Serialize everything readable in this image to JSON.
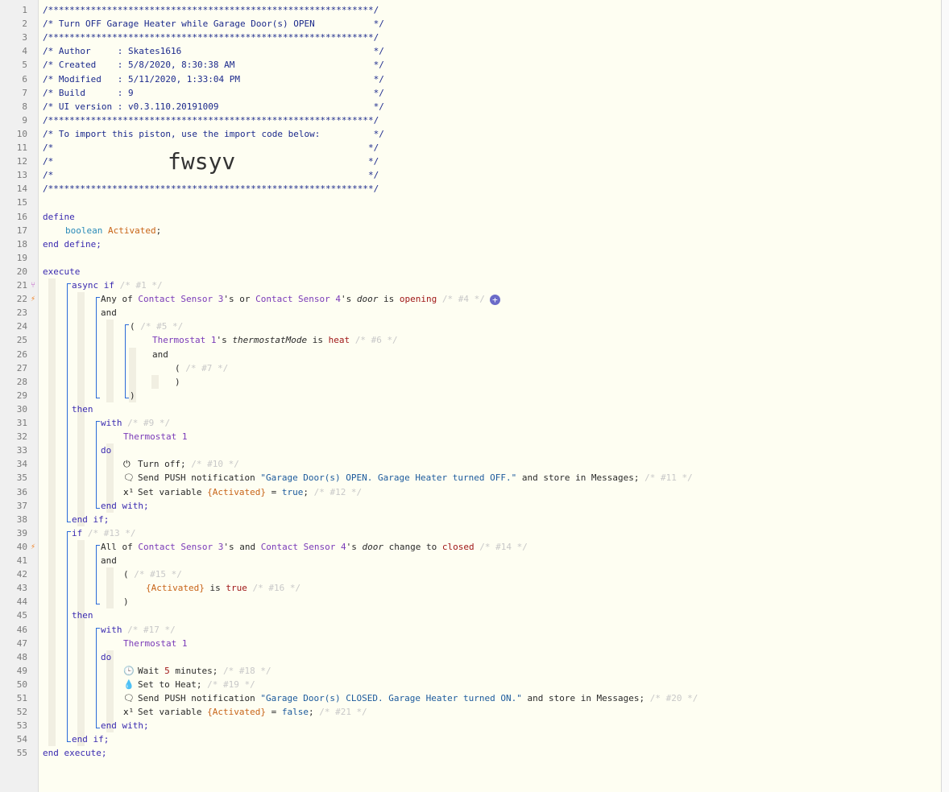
{
  "markers": {
    "21": "branch",
    "22": "bolt",
    "40": "bolt"
  },
  "lines": [
    {
      "n": "1",
      "indent": 0,
      "parts": [
        {
          "t": "/*************************************************************/",
          "c": "cm"
        }
      ]
    },
    {
      "n": "2",
      "indent": 0,
      "parts": [
        {
          "t": "/* Turn OFF Garage Heater while Garage Door(s) OPEN           */",
          "c": "cm"
        }
      ]
    },
    {
      "n": "3",
      "indent": 0,
      "parts": [
        {
          "t": "/*************************************************************/",
          "c": "cm"
        }
      ]
    },
    {
      "n": "4",
      "indent": 0,
      "parts": [
        {
          "t": "/* Author     : Skates1616                                    */",
          "c": "cm"
        }
      ]
    },
    {
      "n": "5",
      "indent": 0,
      "parts": [
        {
          "t": "/* Created    : 5/8/2020, 8:30:38 AM                          */",
          "c": "cm"
        }
      ]
    },
    {
      "n": "6",
      "indent": 0,
      "parts": [
        {
          "t": "/* Modified   : 5/11/2020, 1:33:04 PM                         */",
          "c": "cm"
        }
      ]
    },
    {
      "n": "7",
      "indent": 0,
      "parts": [
        {
          "t": "/* Build      : 9                                             */",
          "c": "cm"
        }
      ]
    },
    {
      "n": "8",
      "indent": 0,
      "parts": [
        {
          "t": "/* UI version : v0.3.110.20191009                             */",
          "c": "cm"
        }
      ]
    },
    {
      "n": "9",
      "indent": 0,
      "parts": [
        {
          "t": "/*************************************************************/",
          "c": "cm"
        }
      ]
    },
    {
      "n": "10",
      "indent": 0,
      "parts": [
        {
          "t": "/* To import this piston, use the import code below:          */",
          "c": "cm"
        }
      ]
    },
    {
      "n": "11",
      "indent": 0,
      "parts": [
        {
          "t": "/*                                                           */",
          "c": "cm"
        }
      ]
    },
    {
      "n": "12",
      "indent": 0,
      "parts": [
        {
          "t": "/*                                                           */",
          "c": "cm"
        }
      ],
      "big": "fwsyv"
    },
    {
      "n": "13",
      "indent": 0,
      "parts": [
        {
          "t": "/*                                                           */",
          "c": "cm"
        }
      ]
    },
    {
      "n": "14",
      "indent": 0,
      "parts": [
        {
          "t": "/*************************************************************/",
          "c": "cm"
        }
      ]
    },
    {
      "n": "15",
      "indent": 0,
      "parts": []
    },
    {
      "n": "16",
      "indent": 0,
      "parts": [
        {
          "t": "define",
          "c": "kw"
        }
      ]
    },
    {
      "n": "17",
      "indent": 28,
      "parts": [
        {
          "t": "boolean",
          "c": "ty"
        },
        {
          "t": " "
        },
        {
          "t": "Activated",
          "c": "va"
        },
        {
          "t": ";"
        }
      ]
    },
    {
      "n": "18",
      "indent": 0,
      "parts": [
        {
          "t": "end define;",
          "c": "kw"
        }
      ]
    },
    {
      "n": "19",
      "indent": 0,
      "parts": []
    },
    {
      "n": "20",
      "indent": 0,
      "parts": [
        {
          "t": "execute",
          "c": "kw"
        }
      ]
    },
    {
      "n": "21",
      "indent": 36,
      "parts": [
        {
          "t": "async if",
          "c": "kw"
        },
        {
          "t": " "
        },
        {
          "t": "/* #1 */",
          "c": "gr"
        }
      ]
    },
    {
      "n": "22",
      "indent": 72,
      "parts": [
        {
          "t": "Any of "
        },
        {
          "t": "Contact Sensor 3",
          "c": "dev"
        },
        {
          "t": "'s or "
        },
        {
          "t": "Contact Sensor 4",
          "c": "dev"
        },
        {
          "t": "'s "
        },
        {
          "t": "door",
          "c": "it"
        },
        {
          "t": " is "
        },
        {
          "t": "opening",
          "c": "op"
        },
        {
          "t": " "
        },
        {
          "t": "/* #4 */",
          "c": "gr"
        }
      ],
      "plus": "+"
    },
    {
      "n": "23",
      "indent": 72,
      "parts": [
        {
          "t": "and"
        }
      ]
    },
    {
      "n": "24",
      "indent": 108,
      "parts": [
        {
          "t": "( "
        },
        {
          "t": "/* #5 */",
          "c": "gr"
        }
      ]
    },
    {
      "n": "25",
      "indent": 136,
      "parts": [
        {
          "t": "Thermostat 1",
          "c": "dev"
        },
        {
          "t": "'s "
        },
        {
          "t": "thermostatMode",
          "c": "it"
        },
        {
          "t": " is "
        },
        {
          "t": "heat",
          "c": "op"
        },
        {
          "t": " "
        },
        {
          "t": "/* #6 */",
          "c": "gr"
        }
      ]
    },
    {
      "n": "26",
      "indent": 136,
      "parts": [
        {
          "t": "and"
        }
      ]
    },
    {
      "n": "27",
      "indent": 164,
      "parts": [
        {
          "t": "( "
        },
        {
          "t": "/* #7 */",
          "c": "gr"
        }
      ]
    },
    {
      "n": "28",
      "indent": 164,
      "parts": [
        {
          "t": ")"
        }
      ]
    },
    {
      "n": "29",
      "indent": 108,
      "parts": [
        {
          "t": ")"
        }
      ]
    },
    {
      "n": "30",
      "indent": 36,
      "parts": [
        {
          "t": "then",
          "c": "kw"
        }
      ]
    },
    {
      "n": "31",
      "indent": 72,
      "parts": [
        {
          "t": "with",
          "c": "kw"
        },
        {
          "t": " "
        },
        {
          "t": "/* #9 */",
          "c": "gr"
        }
      ]
    },
    {
      "n": "32",
      "indent": 100,
      "parts": [
        {
          "t": "Thermostat 1",
          "c": "dev"
        }
      ]
    },
    {
      "n": "33",
      "indent": 72,
      "parts": [
        {
          "t": "do",
          "c": "kw"
        }
      ]
    },
    {
      "n": "34",
      "indent": 100,
      "icon": "power-icon",
      "glyph": "⏻",
      "parts": [
        {
          "t": "Turn off; "
        },
        {
          "t": "/* #10 */",
          "c": "gr"
        }
      ]
    },
    {
      "n": "35",
      "indent": 100,
      "icon": "message-icon",
      "glyph": "🗨",
      "parts": [
        {
          "t": "Send PUSH notification "
        },
        {
          "t": "\"Garage Door(s) OPEN. Garage Heater turned OFF.\"",
          "c": "st"
        },
        {
          "t": " and store in Messages; "
        },
        {
          "t": "/* #11 */",
          "c": "gr"
        }
      ]
    },
    {
      "n": "36",
      "indent": 100,
      "icon": "variable-icon",
      "glyph": "x¹",
      "parts": [
        {
          "t": "Set variable "
        },
        {
          "t": "{Activated}",
          "c": "va"
        },
        {
          "t": " = "
        },
        {
          "t": "true",
          "c": "st"
        },
        {
          "t": "; "
        },
        {
          "t": "/* #12 */",
          "c": "gr"
        }
      ]
    },
    {
      "n": "37",
      "indent": 72,
      "parts": [
        {
          "t": "end with;",
          "c": "kw"
        }
      ]
    },
    {
      "n": "38",
      "indent": 36,
      "parts": [
        {
          "t": "end if;",
          "c": "kw"
        }
      ]
    },
    {
      "n": "39",
      "indent": 36,
      "parts": [
        {
          "t": "if",
          "c": "kw"
        },
        {
          "t": " "
        },
        {
          "t": "/* #13 */",
          "c": "gr"
        }
      ]
    },
    {
      "n": "40",
      "indent": 72,
      "parts": [
        {
          "t": "All of "
        },
        {
          "t": "Contact Sensor 3",
          "c": "dev"
        },
        {
          "t": "'s and "
        },
        {
          "t": "Contact Sensor 4",
          "c": "dev"
        },
        {
          "t": "'s "
        },
        {
          "t": "door",
          "c": "it"
        },
        {
          "t": " change to "
        },
        {
          "t": "closed",
          "c": "op"
        },
        {
          "t": " "
        },
        {
          "t": "/* #14 */",
          "c": "gr"
        }
      ]
    },
    {
      "n": "41",
      "indent": 72,
      "parts": [
        {
          "t": "and"
        }
      ]
    },
    {
      "n": "42",
      "indent": 100,
      "parts": [
        {
          "t": "( "
        },
        {
          "t": "/* #15 */",
          "c": "gr"
        }
      ]
    },
    {
      "n": "43",
      "indent": 128,
      "parts": [
        {
          "t": "{Activated}",
          "c": "va"
        },
        {
          "t": " is "
        },
        {
          "t": "true",
          "c": "op"
        },
        {
          "t": " "
        },
        {
          "t": "/* #16 */",
          "c": "gr"
        }
      ]
    },
    {
      "n": "44",
      "indent": 100,
      "parts": [
        {
          "t": ")"
        }
      ]
    },
    {
      "n": "45",
      "indent": 36,
      "parts": [
        {
          "t": "then",
          "c": "kw"
        }
      ]
    },
    {
      "n": "46",
      "indent": 72,
      "parts": [
        {
          "t": "with",
          "c": "kw"
        },
        {
          "t": " "
        },
        {
          "t": "/* #17 */",
          "c": "gr"
        }
      ]
    },
    {
      "n": "47",
      "indent": 100,
      "parts": [
        {
          "t": "Thermostat 1",
          "c": "dev"
        }
      ]
    },
    {
      "n": "48",
      "indent": 72,
      "parts": [
        {
          "t": "do",
          "c": "kw"
        }
      ]
    },
    {
      "n": "49",
      "indent": 100,
      "icon": "clock-icon",
      "glyph": "🕒",
      "parts": [
        {
          "t": "Wait "
        },
        {
          "t": "5",
          "c": "op"
        },
        {
          "t": " minutes; "
        },
        {
          "t": "/* #18 */",
          "c": "gr"
        }
      ]
    },
    {
      "n": "50",
      "indent": 100,
      "icon": "flame-icon",
      "glyph": "💧",
      "parts": [
        {
          "t": "Set to Heat; "
        },
        {
          "t": "/* #19 */",
          "c": "gr"
        }
      ]
    },
    {
      "n": "51",
      "indent": 100,
      "icon": "message-icon",
      "glyph": "🗨",
      "parts": [
        {
          "t": "Send PUSH notification "
        },
        {
          "t": "\"Garage Door(s) CLOSED. Garage Heater turned ON.\"",
          "c": "st"
        },
        {
          "t": " and store in Messages; "
        },
        {
          "t": "/* #20 */",
          "c": "gr"
        }
      ]
    },
    {
      "n": "52",
      "indent": 100,
      "icon": "variable-icon",
      "glyph": "x¹",
      "parts": [
        {
          "t": "Set variable "
        },
        {
          "t": "{Activated}",
          "c": "va"
        },
        {
          "t": " = "
        },
        {
          "t": "false",
          "c": "st"
        },
        {
          "t": "; "
        },
        {
          "t": "/* #21 */",
          "c": "gr"
        }
      ]
    },
    {
      "n": "53",
      "indent": 72,
      "parts": [
        {
          "t": "end with;",
          "c": "kw"
        }
      ]
    },
    {
      "n": "54",
      "indent": 36,
      "parts": [
        {
          "t": "end if;",
          "c": "kw"
        }
      ]
    },
    {
      "n": "55",
      "indent": 0,
      "parts": [
        {
          "t": "end execute;",
          "c": "kw"
        }
      ]
    }
  ]
}
